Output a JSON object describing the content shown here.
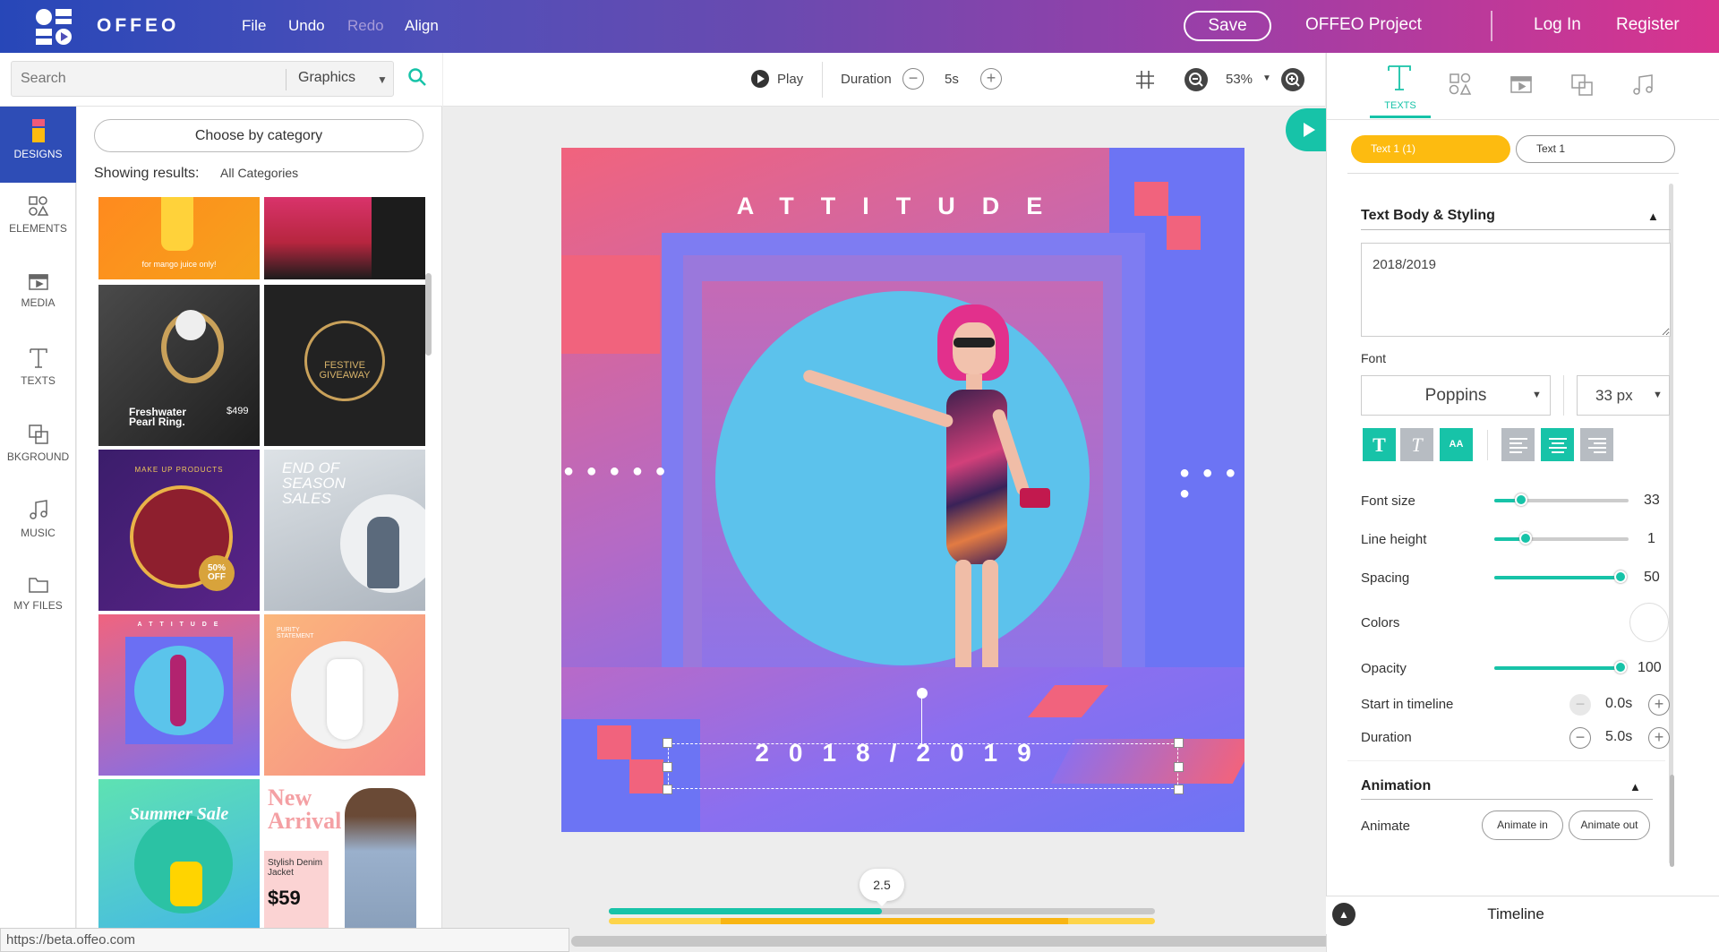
{
  "topbar": {
    "brand": "OFFEO",
    "menu": [
      "File",
      "Undo",
      "Redo",
      "Align"
    ],
    "save_label": "Save",
    "project_name": "OFFEO Project",
    "login_label": "Log In",
    "register_label": "Register"
  },
  "search": {
    "placeholder": "Search",
    "category": "Graphics"
  },
  "rail": [
    {
      "label": "DESIGNS",
      "icon": "designs-icon"
    },
    {
      "label": "ELEMENTS",
      "icon": "elements-icon"
    },
    {
      "label": "MEDIA",
      "icon": "media-icon"
    },
    {
      "label": "TEXTS",
      "icon": "texts-icon"
    },
    {
      "label": "BKGROUND",
      "icon": "background-icon"
    },
    {
      "label": "MUSIC",
      "icon": "music-icon"
    },
    {
      "label": "MY FILES",
      "icon": "folder-icon"
    }
  ],
  "panel": {
    "choose_label": "Choose by category",
    "results_label": "Showing results:",
    "results_value": "All Categories",
    "thumbs": [
      {
        "text": "for mango juice only!"
      },
      {
        "text": ""
      },
      {
        "text": "Freshwater Pearl Ring.",
        "price": "$499"
      },
      {
        "text": "FESTIVE GIVEAWAY"
      },
      {
        "text": "MAKE UP PRODUCTS",
        "price": "50% OFF"
      },
      {
        "text": "END OF SEASON SALES"
      },
      {
        "text": "A T T I T U D E"
      },
      {
        "text": "PURITY STATEMENT"
      },
      {
        "text": "Summer Sale"
      },
      {
        "text": "New Arrival",
        "sub": "Stylish Denim Jacket",
        "price": "$59"
      }
    ]
  },
  "status_url": "https://beta.offeo.com",
  "toolbar": {
    "play_label": "Play",
    "duration_label": "Duration",
    "duration_value": "5s",
    "zoom_value": "53%"
  },
  "canvas": {
    "title": "ATTITUDE",
    "year": "2018/2019"
  },
  "right": {
    "tab_label": "TEXTS",
    "layer_tabs": [
      "Text 1 (1)",
      "Text 1"
    ],
    "section_title": "Text Body & Styling",
    "text_body": "2018/2019",
    "font_label": "Font",
    "font_family": "Poppins",
    "font_px": "33 px",
    "font_size_label": "Font size",
    "font_size_value": "33",
    "line_height_label": "Line height",
    "line_height_value": "1",
    "spacing_label": "Spacing",
    "spacing_value": "50",
    "colors_label": "Colors",
    "opacity_label": "Opacity",
    "opacity_value": "100",
    "start_label": "Start in timeline",
    "start_value": "0.0s",
    "duration_label": "Duration",
    "duration_value": "5.0s",
    "animation_title": "Animation",
    "animate_label": "Animate",
    "animate_in": "Animate in",
    "animate_out": "Animate out",
    "timeline_label": "Timeline"
  },
  "timeline": {
    "playhead": "2.5",
    "progress": 0.5
  },
  "colors": {
    "accent": "#17c3a8",
    "brand_blue": "#2e4db6",
    "layer_active": "#fdbb10"
  }
}
